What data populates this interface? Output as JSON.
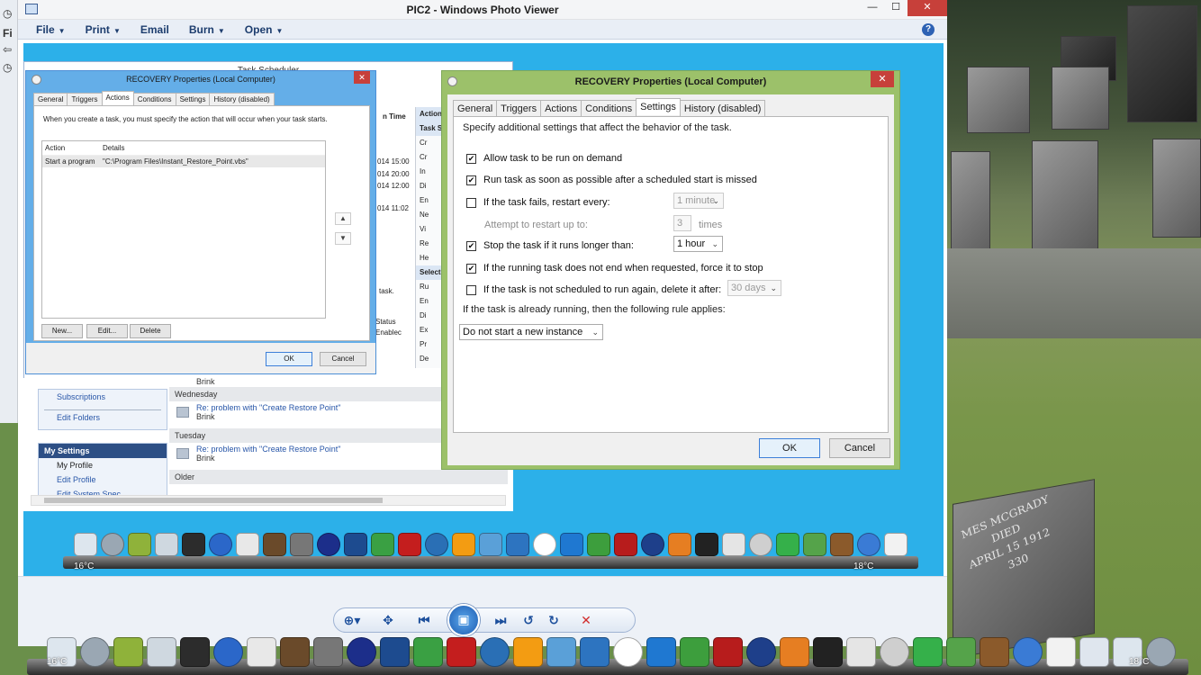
{
  "window": {
    "title": "PIC2 - Windows Photo Viewer",
    "menu": [
      {
        "label": "File",
        "dropdown": true
      },
      {
        "label": "Print",
        "dropdown": true
      },
      {
        "label": "Email",
        "dropdown": false
      },
      {
        "label": "Burn",
        "dropdown": true
      },
      {
        "label": "Open",
        "dropdown": true
      }
    ],
    "help": "?",
    "left_strip_label": "Fi"
  },
  "task_scheduler": {
    "title": "Task Scheduler",
    "col_time": "n Time",
    "times": [
      "014 15:00",
      "014 20:00",
      "014 12:00",
      "014 11:02"
    ],
    "actions_header": "Action",
    "actions_sub": "Task S",
    "actions_items": [
      "Cr",
      "Cr",
      "In",
      "Di",
      "En",
      "Ne",
      "Vi",
      "Re",
      "He"
    ],
    "selected_header": "Select",
    "selected_items": [
      "Ru",
      "En",
      "Di",
      "Ex",
      "Pr",
      "De"
    ],
    "status_label": "Status",
    "status_value": "Enablec",
    "task_fragment": "task."
  },
  "forum": {
    "subscriptions": "Subscriptions",
    "edit_folders": "Edit Folders",
    "my_settings": "My Settings",
    "my_profile": "My Profile",
    "edit_profile": "Edit Profile",
    "edit_system_spec": "Edit System Spec",
    "author_top": "Brink",
    "groups": [
      {
        "date": "Wednesday",
        "subject": "Re: problem with \"Create Restore Point\"",
        "author": "Brink"
      },
      {
        "date": "Tuesday",
        "subject": "Re: problem with \"Create Restore Point\"",
        "author": "Brink"
      }
    ],
    "older": "Older"
  },
  "dialog_actions": {
    "title": "RECOVERY Properties (Local Computer)",
    "tabs": [
      "General",
      "Triggers",
      "Actions",
      "Conditions",
      "Settings",
      "History (disabled)"
    ],
    "active_tab": "Actions",
    "intro": "When you create a task, you must specify the action that will occur when your task starts.",
    "columns": [
      "Action",
      "Details"
    ],
    "rows": [
      {
        "action": "Start a program",
        "details": "\"C:\\Program Files\\Instant_Restore_Point.vbs\""
      }
    ],
    "buttons": {
      "new": "New...",
      "edit": "Edit...",
      "delete": "Delete",
      "ok": "OK",
      "cancel": "Cancel"
    }
  },
  "dialog_settings": {
    "title": "RECOVERY Properties (Local Computer)",
    "tabs": [
      "General",
      "Triggers",
      "Actions",
      "Conditions",
      "Settings",
      "History (disabled)"
    ],
    "active_tab": "Settings",
    "description": "Specify additional settings that affect the behavior of the task.",
    "options": {
      "allow_on_demand": {
        "label": "Allow task to be run on demand",
        "checked": true
      },
      "run_asap": {
        "label": "Run task as soon as possible after a scheduled start is missed",
        "checked": true
      },
      "restart_every": {
        "label": "If the task fails, restart every:",
        "checked": false,
        "value": "1 minute"
      },
      "restart_attempts": {
        "label": "Attempt to restart up to:",
        "value": "3",
        "unit": "times"
      },
      "stop_longer": {
        "label": "Stop the task if it runs longer than:",
        "checked": true,
        "value": "1 hour"
      },
      "force_stop": {
        "label": "If the running task does not end when requested, force it to stop",
        "checked": true
      },
      "delete_after": {
        "label": "If the task is not scheduled to run again, delete it after:",
        "checked": false,
        "value": "30 days"
      }
    },
    "rule_label": "If the task is already running, then the following rule applies:",
    "rule_value": "Do not start a new instance",
    "buttons": {
      "ok": "OK",
      "cancel": "Cancel"
    }
  },
  "dock_top": {
    "temp": "16°C",
    "temp_right": "18°C"
  },
  "dock_bottom": {
    "temp": "16°C",
    "temp_right": "18°C"
  },
  "gravestone_text": [
    "MES MCGRADY",
    "DIED",
    "APRIL 15 1912",
    "330"
  ],
  "colors": {
    "photo_blue": "#2cb0e9",
    "accent_blue": "#4c8fd6",
    "dialog_green": "#9cc16a",
    "close_red": "#c7403a"
  }
}
